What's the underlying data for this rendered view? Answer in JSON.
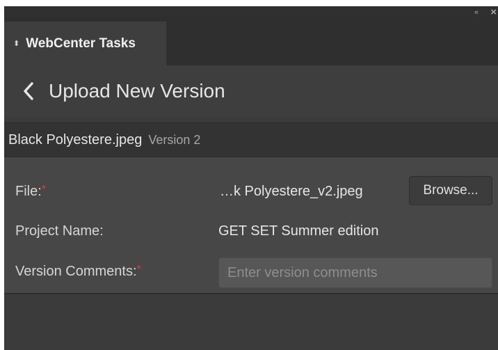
{
  "panel": {
    "collapse_glyph": "«",
    "close_glyph": "×"
  },
  "tab": {
    "icon_glyph": "⬍",
    "label": "WebCenter Tasks"
  },
  "header": {
    "title": "Upload New Version"
  },
  "file_bar": {
    "name": "Black Polyestere.jpeg",
    "version": "Version 2"
  },
  "form": {
    "file_label": "File:",
    "file_value": "…k Polyestere_v2.jpeg",
    "browse_label": "Browse...",
    "project_label": "Project Name:",
    "project_value": "GET SET Summer edition",
    "comments_label": "Version Comments:",
    "comments_placeholder": "Enter version comments",
    "required_marker": "*"
  },
  "colors": {
    "panel_bg": "#3b3b3b",
    "form_bg": "#474747",
    "required": "#e03a3a",
    "text": "#e6e6e6"
  }
}
